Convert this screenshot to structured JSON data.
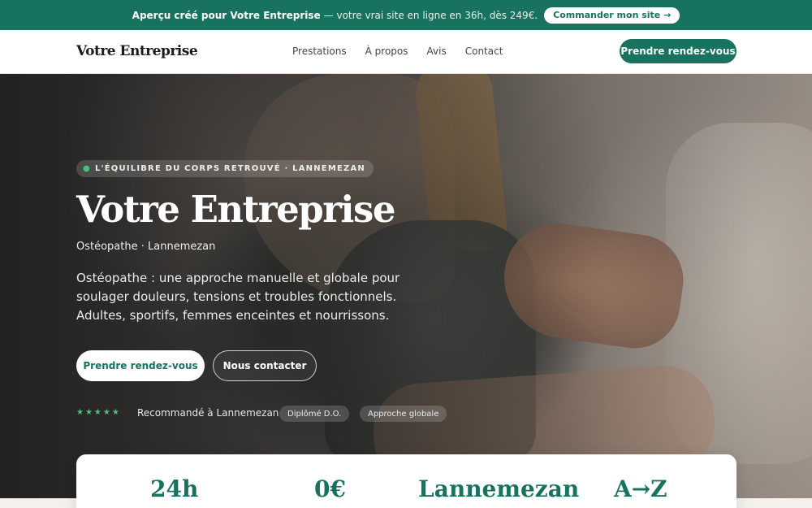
{
  "banner": {
    "strong_text": "Aperçu créé pour Votre Entreprise",
    "rest_text": "— votre vrai site en ligne en 36h, dès 249€.",
    "button_label": "Commander mon site →"
  },
  "nav": {
    "brand": "Votre Entreprise",
    "items": [
      {
        "label": "Prestations"
      },
      {
        "label": "À propos"
      },
      {
        "label": "Avis"
      },
      {
        "label": "Contact"
      }
    ],
    "cta_label": "Prendre rendez-vous"
  },
  "hero": {
    "tagline": "L'ÉQUILIBRE DU CORPS RETROUVÉ · LANNEMEZAN",
    "title": "Votre Entreprise",
    "subtitle": "Ostéopathe · Lannemezan",
    "description": "Ostéopathe : une approche manuelle et globale pour soulager douleurs, tensions et troubles fonctionnels. Adultes, sportifs, femmes enceintes et nourrissons.",
    "primary_button": "Prendre rendez-vous",
    "secondary_button": "Nous contacter",
    "rating_stars": "★★★★★",
    "recommend_text": "Recommandé à Lannemezan",
    "badges": [
      {
        "label": "Diplômé D.O."
      },
      {
        "label": "Approche globale"
      }
    ]
  },
  "stats": [
    {
      "value": "24h"
    },
    {
      "value": "0€"
    },
    {
      "value": "Lannemezan"
    },
    {
      "value": "A→Z"
    }
  ],
  "colors": {
    "accent": "#17725f",
    "star": "#4bc17f"
  }
}
